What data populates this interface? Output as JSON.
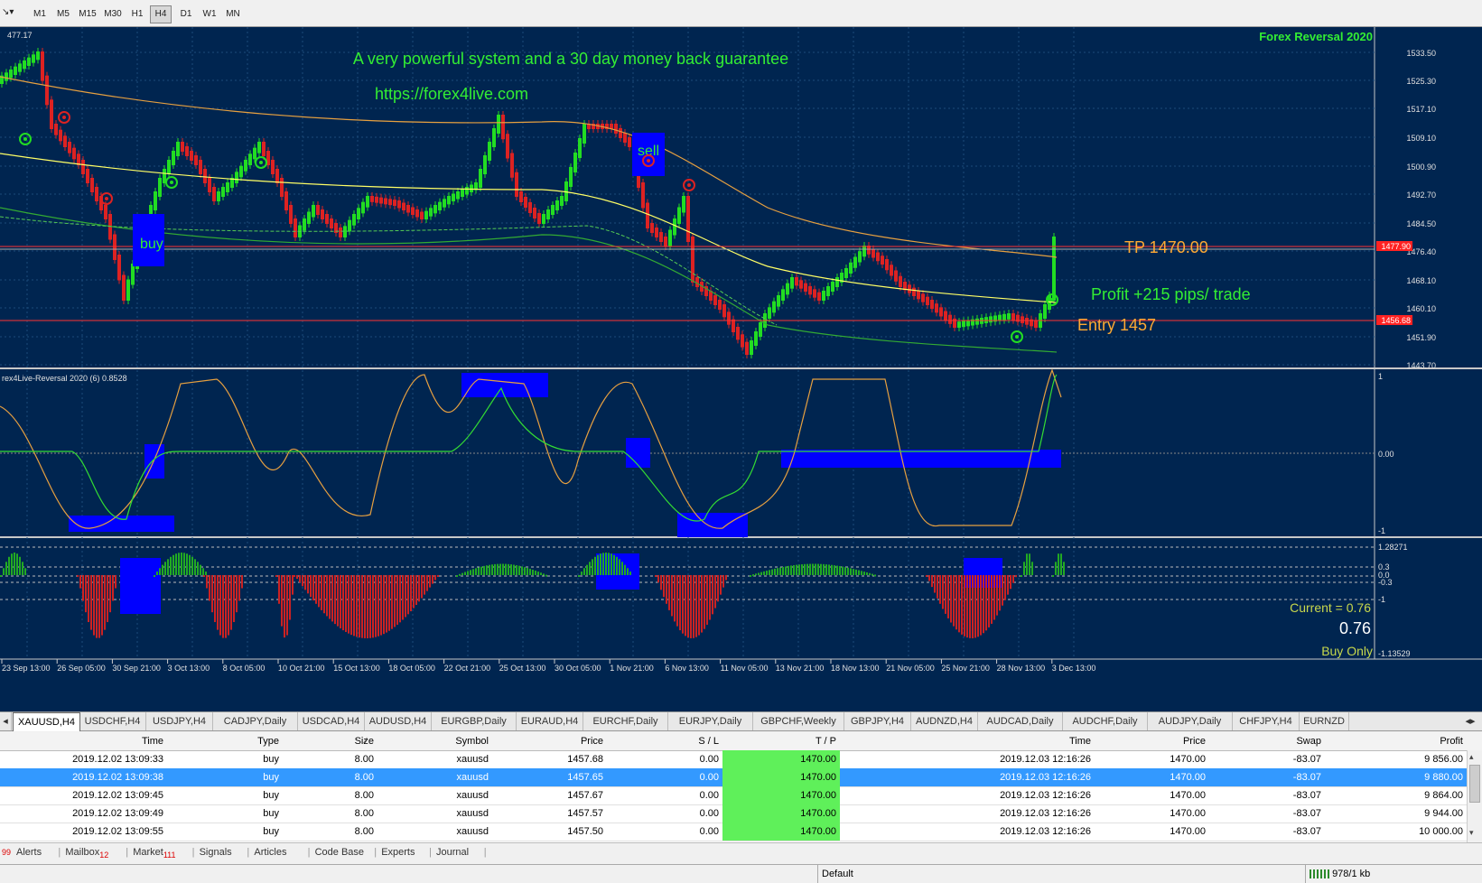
{
  "toolbar": {
    "timeframes": [
      "M1",
      "M5",
      "M15",
      "M30",
      "H1",
      "H4",
      "D1",
      "W1",
      "MN"
    ],
    "active_timeframe": "H4"
  },
  "chart": {
    "top_left_value": "477.17",
    "brand": "Forex Reversal 2020",
    "headline": "A very powerful system and a 30 day money back guarantee",
    "url": "https://forex4live.com",
    "buy_label": "buy",
    "sell_label": "sell",
    "tp_label": "TP 1470.00",
    "profit_label": "Profit +215 pips/ trade",
    "entry_label": "Entry 1457",
    "price_axis": [
      "1533.50",
      "1525.30",
      "1517.10",
      "1509.10",
      "1500.90",
      "1492.70",
      "1484.50",
      "1476.40",
      "1468.10",
      "1460.10",
      "1451.90",
      "1443.70"
    ],
    "tp_price_tag": "1477.90",
    "entry_price_tag": "1456.68",
    "indicator1_title": "rex4Live-Reversal 2020 (6) 0.8528",
    "indicator1_axis": [
      "1",
      "0.00",
      "-1"
    ],
    "indicator2_axis": [
      "1.28271",
      "0.3",
      "0.0",
      "-0.3",
      "-1",
      "-1.13529"
    ],
    "current_label": "Current = 0.76",
    "current_value": "0.76",
    "signal_label": "Buy Only",
    "date_axis": [
      "23 Sep 13:00",
      "26 Sep 05:00",
      "30 Sep 21:00",
      "3 Oct 13:00",
      "8 Oct 05:00",
      "10 Oct 21:00",
      "15 Oct 13:00",
      "18 Oct 05:00",
      "22 Oct 21:00",
      "25 Oct 13:00",
      "30 Oct 05:00",
      "1 Nov 21:00",
      "6 Nov 13:00",
      "11 Nov 05:00",
      "13 Nov 21:00",
      "18 Nov 13:00",
      "21 Nov 05:00",
      "25 Nov 21:00",
      "28 Nov 13:00",
      "3 Dec 13:00"
    ],
    "colors": {
      "bg": "#002550",
      "bull": "#22dd22",
      "bear": "#dd2222",
      "text_green": "#33ee33",
      "text_orange": "#ffaa33",
      "signal_box": "#0000ff"
    }
  },
  "symbol_tabs": [
    "XAUUSD,H4",
    "USDCHF,H4",
    "USDJPY,H4",
    "CADJPY,Daily",
    "USDCAD,H4",
    "AUDUSD,H4",
    "EURGBP,Daily",
    "EURAUD,H4",
    "EURCHF,Daily",
    "EURJPY,Daily",
    "GBPCHF,Weekly",
    "GBPJPY,H4",
    "AUDNZD,H4",
    "AUDCAD,Daily",
    "AUDCHF,Daily",
    "AUDJPY,Daily",
    "CHFJPY,H4",
    "EURNZD"
  ],
  "orders": {
    "columns": [
      "Time",
      "Type",
      "Size",
      "Symbol",
      "Price",
      "S / L",
      "T / P",
      "Time",
      "Price",
      "Swap",
      "Profit"
    ],
    "rows": [
      [
        "2019.12.02 13:09:33",
        "buy",
        "8.00",
        "xauusd",
        "1457.68",
        "0.00",
        "1470.00",
        "2019.12.03 12:16:26",
        "1470.00",
        "-83.07",
        "9 856.00"
      ],
      [
        "2019.12.02 13:09:38",
        "buy",
        "8.00",
        "xauusd",
        "1457.65",
        "0.00",
        "1470.00",
        "2019.12.03 12:16:26",
        "1470.00",
        "-83.07",
        "9 880.00"
      ],
      [
        "2019.12.02 13:09:45",
        "buy",
        "8.00",
        "xauusd",
        "1457.67",
        "0.00",
        "1470.00",
        "2019.12.03 12:16:26",
        "1470.00",
        "-83.07",
        "9 864.00"
      ],
      [
        "2019.12.02 13:09:49",
        "buy",
        "8.00",
        "xauusd",
        "1457.57",
        "0.00",
        "1470.00",
        "2019.12.03 12:16:26",
        "1470.00",
        "-83.07",
        "9 944.00"
      ],
      [
        "2019.12.02 13:09:55",
        "buy",
        "8.00",
        "xauusd",
        "1457.50",
        "0.00",
        "1470.00",
        "2019.12.03 12:16:26",
        "1470.00",
        "-83.07",
        "10 000.00"
      ]
    ],
    "selected_row": 1
  },
  "bottom_tabs": {
    "first_badge": "99",
    "items": [
      {
        "label": "Alerts",
        "badge": ""
      },
      {
        "label": "Mailbox",
        "badge": "12"
      },
      {
        "label": "Market",
        "badge": "111"
      },
      {
        "label": "Signals",
        "badge": ""
      },
      {
        "label": "Articles",
        "badge": ""
      },
      {
        "label": "Code Base",
        "badge": ""
      },
      {
        "label": "Experts",
        "badge": ""
      },
      {
        "label": "Journal",
        "badge": ""
      }
    ]
  },
  "status": {
    "profile": "Default",
    "traffic": "978/1 kb"
  }
}
